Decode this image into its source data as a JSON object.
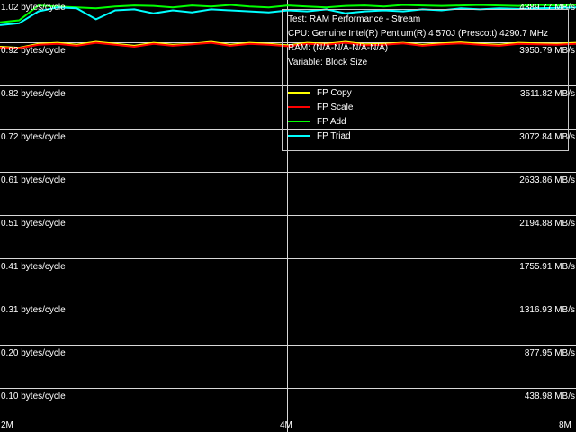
{
  "info": {
    "test": "Test: RAM Performance - Stream",
    "cpu": "CPU: Genuine Intel(R) Pentium(R) 4 570J (Prescott) 4290.7 MHz",
    "ram": "RAM:  (N/A-N/A-N/A-N/A)",
    "variable": "Variable: Block Size"
  },
  "chart_data": {
    "type": "line",
    "x": [
      "2M",
      "4M",
      "8M"
    ],
    "x_tick_labels": [
      "2M",
      "4M",
      "8M"
    ],
    "y_left_ticks": [
      "1.02 bytes/cycle",
      "0.92 bytes/cycle",
      "0.82 bytes/cycle",
      "0.72 bytes/cycle",
      "0.61 bytes/cycle",
      "0.51 bytes/cycle",
      "0.41 bytes/cycle",
      "0.31 bytes/cycle",
      "0.20 bytes/cycle",
      "0.10 bytes/cycle"
    ],
    "y_right_ticks": [
      "4389.77 MB/s",
      "3950.79 MB/s",
      "3511.82 MB/s",
      "3072.84 MB/s",
      "2633.86 MB/s",
      "2194.88 MB/s",
      "1755.91 MB/s",
      "1316.93 MB/s",
      "877.95 MB/s",
      "438.98 MB/s"
    ],
    "ylim_mbs": [
      0,
      4389.77
    ],
    "grid": true,
    "legend_position": "top-right",
    "series": [
      {
        "name": "FP Copy",
        "color": "#ffff00",
        "values": [
          3960,
          3950,
          3990,
          4000,
          3980,
          4010,
          3990,
          3970,
          4000,
          3980,
          3990,
          4010,
          3980,
          4000,
          3990,
          3975,
          4000,
          3990,
          4010,
          3985,
          3990,
          4000,
          3980,
          3995,
          4005,
          3990,
          3980,
          4000,
          3995,
          3990,
          4000
        ]
      },
      {
        "name": "FP Scale",
        "color": "#ff0000",
        "values": [
          3950,
          3945,
          3980,
          3990,
          3970,
          4000,
          3980,
          3960,
          3990,
          3970,
          3985,
          4000,
          3970,
          3990,
          3980,
          3965,
          3990,
          3980,
          4000,
          3975,
          3980,
          3995,
          3970,
          3985,
          3995,
          3980,
          3970,
          3990,
          3985,
          3980,
          3990
        ]
      },
      {
        "name": "FP Add",
        "color": "#00ff00",
        "values": [
          4210,
          4230,
          4380,
          4370,
          4360,
          4350,
          4370,
          4380,
          4375,
          4360,
          4380,
          4370,
          4385,
          4370,
          4360,
          4380,
          4370,
          4360,
          4375,
          4380,
          4370,
          4385,
          4380,
          4375,
          4380,
          4385,
          4380,
          4375,
          4385,
          4380,
          4385
        ]
      },
      {
        "name": "FP Triad",
        "color": "#00ffff",
        "values": [
          4180,
          4200,
          4320,
          4360,
          4350,
          4240,
          4330,
          4340,
          4300,
          4330,
          4310,
          4340,
          4330,
          4320,
          4310,
          4330,
          4320,
          4340,
          4300,
          4320,
          4330,
          4320,
          4340,
          4330,
          4350,
          4340,
          4350,
          4345,
          4350,
          4355,
          4360
        ]
      }
    ]
  }
}
